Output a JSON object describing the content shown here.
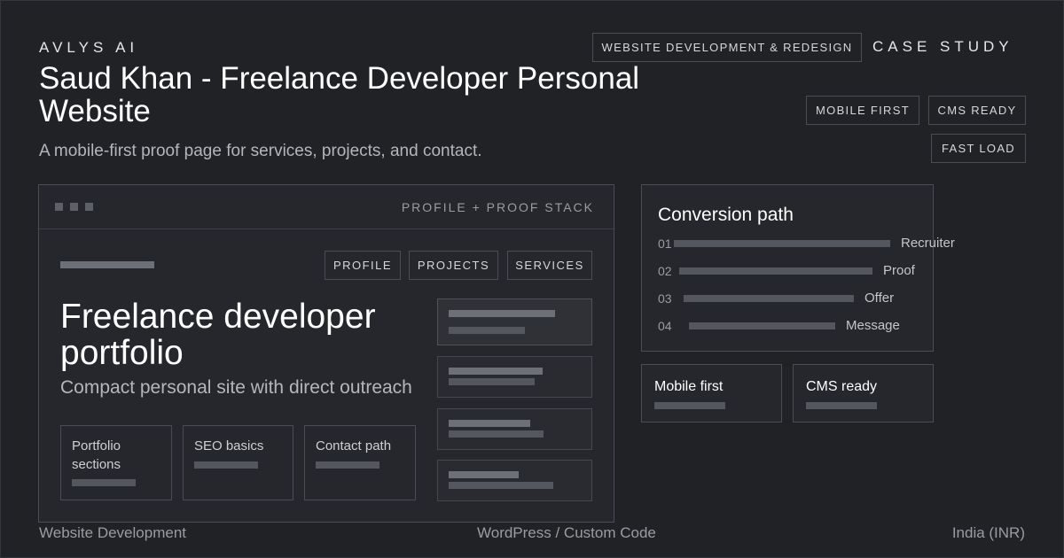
{
  "header": {
    "brand": "AVLYS AI",
    "title": "Saud Khan - Freelance Developer Personal Website",
    "subtitle": "A mobile-first proof page for services, projects, and contact.",
    "category_tag": "WEBSITE DEVELOPMENT & REDESIGN",
    "case_study": "CASE STUDY",
    "badges": [
      "MOBILE FIRST",
      "CMS READY",
      "FAST LOAD"
    ]
  },
  "mockup": {
    "bar_label": "PROFILE + PROOF STACK",
    "nav": [
      "PROFILE",
      "PROJECTS",
      "SERVICES"
    ],
    "hero_title": "Freelance developer portfolio",
    "hero_subtitle": "Compact personal site with direct outreach",
    "features": [
      "Portfolio sections",
      "SEO basics",
      "Contact path"
    ]
  },
  "conversion": {
    "title": "Conversion path",
    "steps": [
      {
        "num": "01",
        "label": "Recruiter"
      },
      {
        "num": "02",
        "label": "Proof"
      },
      {
        "num": "03",
        "label": "Offer"
      },
      {
        "num": "04",
        "label": "Message"
      }
    ]
  },
  "mini_cards": [
    "Mobile first",
    "CMS ready"
  ],
  "footer": {
    "left": "Website Development",
    "center": "WordPress / Custom Code",
    "right": "India (INR)"
  },
  "colors": {
    "background": "#202226",
    "border": "#4a4d54",
    "text_primary": "#ffffff",
    "text_muted": "#9a9ca1"
  }
}
